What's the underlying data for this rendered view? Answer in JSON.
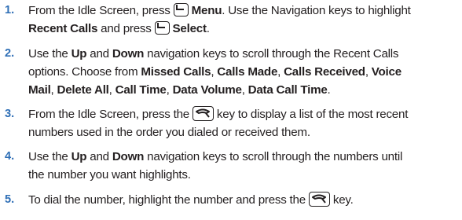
{
  "steps": [
    {
      "number": "1.",
      "lines": [
        {
          "pre": "From the Idle Screen, press ",
          "icon": "soft-left-key-icon",
          "bold": "Menu",
          "post": ". Use the Navigation keys to highlight"
        },
        {
          "bold1": "Recent Calls",
          "mid": " and press ",
          "icon": "soft-left-key-icon",
          "bold2": "Select",
          "post": "."
        }
      ]
    },
    {
      "number": "2.",
      "lines": [
        {
          "t1": "Use the ",
          "b1": "Up",
          "t2": " and ",
          "b2": "Down",
          "t3": " navigation keys to scroll through the Recent Calls"
        },
        {
          "t1": "options. Choose from ",
          "b1": "Missed Calls",
          "t2": ", ",
          "b2": "Calls Made",
          "t3": ", ",
          "b3": "Calls Received",
          "t4": ", ",
          "b4": "Voice"
        },
        {
          "b1": "Mail",
          "t1": ", ",
          "b2": "Delete All",
          "t2": ", ",
          "b3": "Call Time",
          "t3": ", ",
          "b4": "Data Volume",
          "t4": ", ",
          "b5": "Data Call Time",
          "t5": "."
        }
      ]
    },
    {
      "number": "3.",
      "lines": [
        {
          "pre": "From the Idle Screen, press the ",
          "icon": "send-key-icon",
          "post": " key to display a list of the most recent"
        },
        {
          "text": "numbers used in the order you dialed or received them."
        }
      ]
    },
    {
      "number": "4.",
      "lines": [
        {
          "t1": "Use the ",
          "b1": "Up",
          "t2": " and ",
          "b2": "Down",
          "t3": " navigation keys to scroll through the numbers until"
        },
        {
          "text": "the number you want highlights."
        }
      ]
    },
    {
      "number": "5.",
      "lines": [
        {
          "pre": "To dial the number, highlight the number and press the ",
          "icon": "send-key-icon",
          "post": " key."
        }
      ]
    }
  ],
  "colors": {
    "number": "#2f6fb6",
    "text": "#231f20"
  }
}
